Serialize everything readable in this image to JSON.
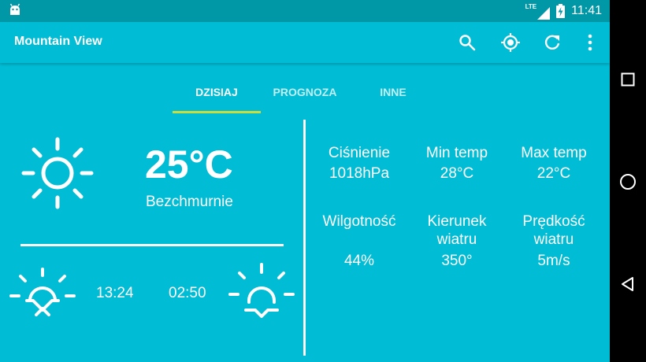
{
  "status_bar": {
    "network": "LTE",
    "time": "11:41"
  },
  "app_bar": {
    "title": "Mountain View",
    "actions": [
      "search-icon",
      "my-location-icon",
      "refresh-icon",
      "more-vert-icon"
    ]
  },
  "tabs": [
    {
      "label": "DZISIAJ",
      "selected": true
    },
    {
      "label": "PROGNOZA",
      "selected": false
    },
    {
      "label": "INNE",
      "selected": false
    }
  ],
  "today": {
    "temperature": "25°C",
    "condition": "Bezchmurnie",
    "sunrise": "13:24",
    "sunset": "02:50"
  },
  "details": {
    "pressure": {
      "label": "Ciśnienie",
      "value": "1018hPa"
    },
    "min_temp": {
      "label": "Min temp",
      "value": "28°C"
    },
    "max_temp": {
      "label": "Max temp",
      "value": "22°C"
    },
    "humidity": {
      "label": "Wilgotność",
      "value": "44%"
    },
    "wind_dir": {
      "label_line1": "Kierunek",
      "label_line2": "wiatru",
      "value": "350°"
    },
    "wind_speed": {
      "label_line1": "Prędkość",
      "label_line2": "wiatru",
      "value": "5m/s"
    }
  },
  "colors": {
    "primary": "#00BCD4",
    "primary_dark": "#0097A7",
    "tab_indicator": "#CDDC39",
    "text": "#FFFFFF"
  }
}
